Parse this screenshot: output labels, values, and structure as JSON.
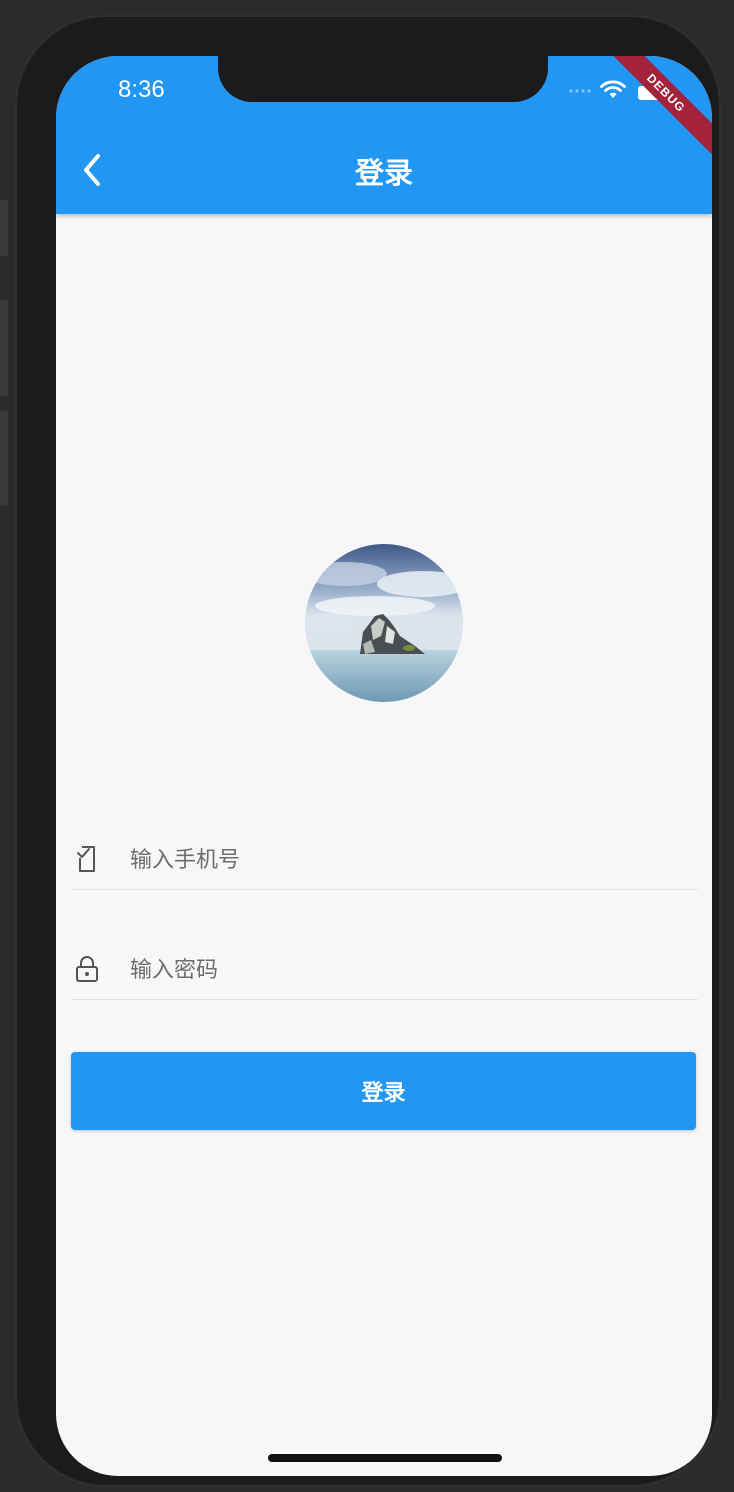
{
  "status_bar": {
    "time": "8:36"
  },
  "debug_banner": "DEBUG",
  "app_bar": {
    "title": "登录",
    "back_icon": "chevron-left-icon"
  },
  "form": {
    "phone": {
      "placeholder": "输入手机号",
      "icon": "phone-icon"
    },
    "password": {
      "placeholder": "输入密码",
      "icon": "lock-icon"
    },
    "submit_label": "登录"
  },
  "colors": {
    "primary": "#2196f3",
    "background": "#f7f7f9",
    "debug": "#a4223a"
  }
}
